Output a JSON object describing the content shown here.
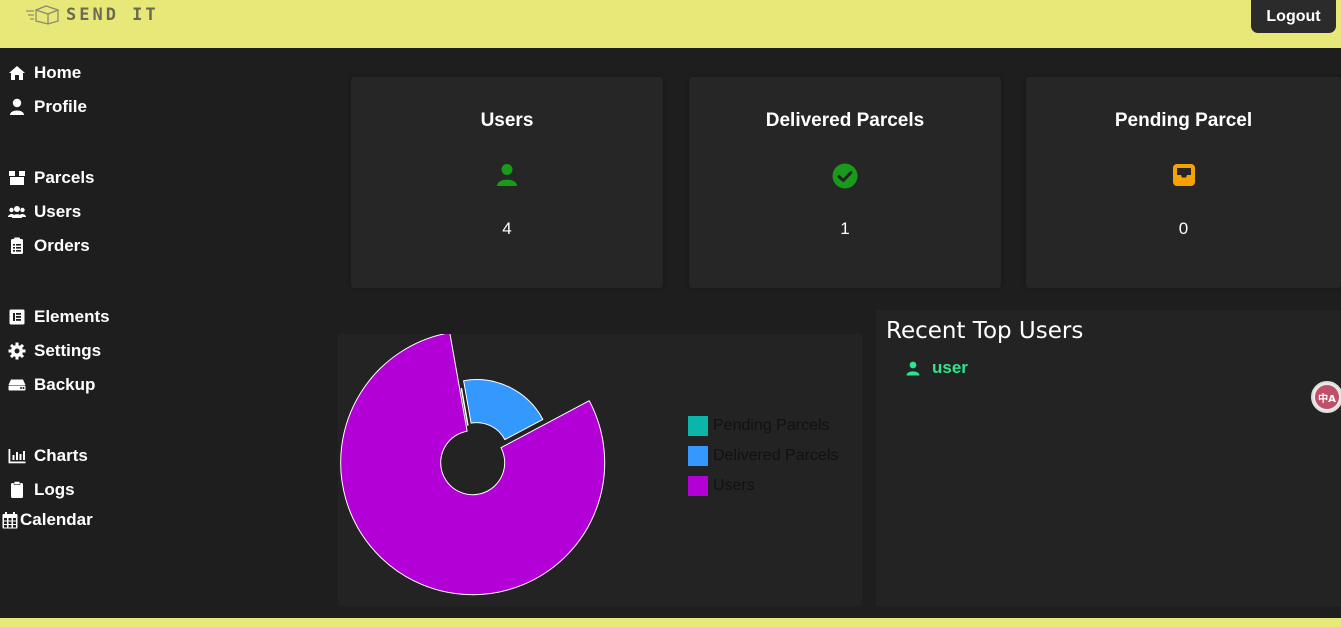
{
  "header": {
    "logo_text": "SEND IT",
    "logout_label": "Logout"
  },
  "sidebar": {
    "items": [
      {
        "label": "Home",
        "icon": "home-icon"
      },
      {
        "label": "Profile",
        "icon": "user-icon"
      },
      {
        "label": "Parcels",
        "icon": "box-icon"
      },
      {
        "label": "Users",
        "icon": "users-icon"
      },
      {
        "label": "Orders",
        "icon": "clipboard-list-icon"
      },
      {
        "label": "Elements",
        "icon": "list-alt-icon"
      },
      {
        "label": "Settings",
        "icon": "gear-icon"
      },
      {
        "label": "Backup",
        "icon": "hdd-icon"
      },
      {
        "label": "Charts",
        "icon": "bar-chart-icon"
      },
      {
        "label": "Logs",
        "icon": "clipboard-icon"
      },
      {
        "label": "Calendar",
        "icon": "calendar-icon"
      }
    ]
  },
  "cards": [
    {
      "title": "Users",
      "value": "4",
      "icon": "user-icon",
      "icon_color": "#1a9a1a"
    },
    {
      "title": "Delivered Parcels",
      "value": "1",
      "icon": "check-circle-icon",
      "icon_color": "#1a9a1a"
    },
    {
      "title": "Pending Parcel",
      "value": "0",
      "icon": "inbox-icon",
      "icon_color": "#f5a300"
    }
  ],
  "recent_users": {
    "title": "Recent Top Users",
    "users": [
      {
        "name": "user"
      }
    ]
  },
  "chart_data": {
    "type": "pie",
    "categories": [
      "Pending Parcels",
      "Delivered Parcels",
      "Users"
    ],
    "values": [
      0,
      1,
      4
    ],
    "colors": [
      "#0bb5a8",
      "#3399ff",
      "#b200d6"
    ],
    "legend_position": "right"
  },
  "translate_badge": {
    "label": "中A"
  }
}
